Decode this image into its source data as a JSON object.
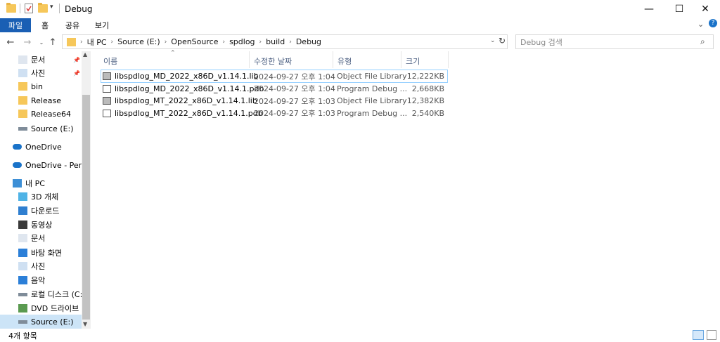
{
  "window": {
    "title": "Debug",
    "minimize": "—",
    "maximize": "☐",
    "close": "✕"
  },
  "ribbon": {
    "tabs": [
      "파일",
      "홈",
      "공유",
      "보기"
    ]
  },
  "address": {
    "crumbs": [
      "내 PC",
      "Source (E:)",
      "OpenSource",
      "spdlog",
      "build",
      "Debug"
    ]
  },
  "search": {
    "placeholder": "Debug 검색"
  },
  "sidebar": {
    "items": [
      {
        "label": "문서",
        "icon": "document-icon",
        "pinned": true
      },
      {
        "label": "사진",
        "icon": "picture-icon",
        "pinned": true
      },
      {
        "label": "bin",
        "icon": "folder-icon"
      },
      {
        "label": "Release",
        "icon": "folder-icon"
      },
      {
        "label": "Release64",
        "icon": "folder-icon"
      },
      {
        "label": "Source (E:)",
        "icon": "drive-icon"
      },
      {
        "label": "OneDrive",
        "icon": "cloud-icon"
      },
      {
        "label": "OneDrive - Personal",
        "icon": "cloud-icon"
      },
      {
        "label": "내 PC",
        "icon": "pc-icon"
      },
      {
        "label": "3D 개체",
        "icon": "3d-objects-icon"
      },
      {
        "label": "다운로드",
        "icon": "download-icon"
      },
      {
        "label": "동영상",
        "icon": "video-icon"
      },
      {
        "label": "문서",
        "icon": "document-icon"
      },
      {
        "label": "바탕 화면",
        "icon": "desktop-icon"
      },
      {
        "label": "사진",
        "icon": "picture-icon"
      },
      {
        "label": "음악",
        "icon": "music-icon"
      },
      {
        "label": "로컬 디스크 (C:)",
        "icon": "drive-icon"
      },
      {
        "label": "DVD 드라이브 (",
        "icon": "dvd-icon"
      },
      {
        "label": "Source (E:)",
        "icon": "drive-icon",
        "selected": true
      }
    ]
  },
  "columns": {
    "name": "이름",
    "date": "수정한 날짜",
    "type": "유형",
    "size": "크기"
  },
  "files": [
    {
      "name": "libspdlog_MD_2022_x86D_v1.14.1.lib",
      "date": "2024-09-27 오후 1:04",
      "type": "Object File Library",
      "size": "12,222KB",
      "icon": "lib-file-icon"
    },
    {
      "name": "libspdlog_MD_2022_x86D_v1.14.1.pdb",
      "date": "2024-09-27 오후 1:04",
      "type": "Program Debug ...",
      "size": "2,668KB",
      "icon": "pdb-file-icon"
    },
    {
      "name": "libspdlog_MT_2022_x86D_v1.14.1.lib",
      "date": "2024-09-27 오후 1:03",
      "type": "Object File Library",
      "size": "12,382KB",
      "icon": "lib-file-icon"
    },
    {
      "name": "libspdlog_MT_2022_x86D_v1.14.1.pdb",
      "date": "2024-09-27 오후 1:03",
      "type": "Program Debug ...",
      "size": "2,540KB",
      "icon": "pdb-file-icon"
    }
  ],
  "status": {
    "count": "4개 항목"
  },
  "colors": {
    "accent": "#1a5fb4",
    "selection": "#cce4f7",
    "header_text": "#4d6082"
  }
}
